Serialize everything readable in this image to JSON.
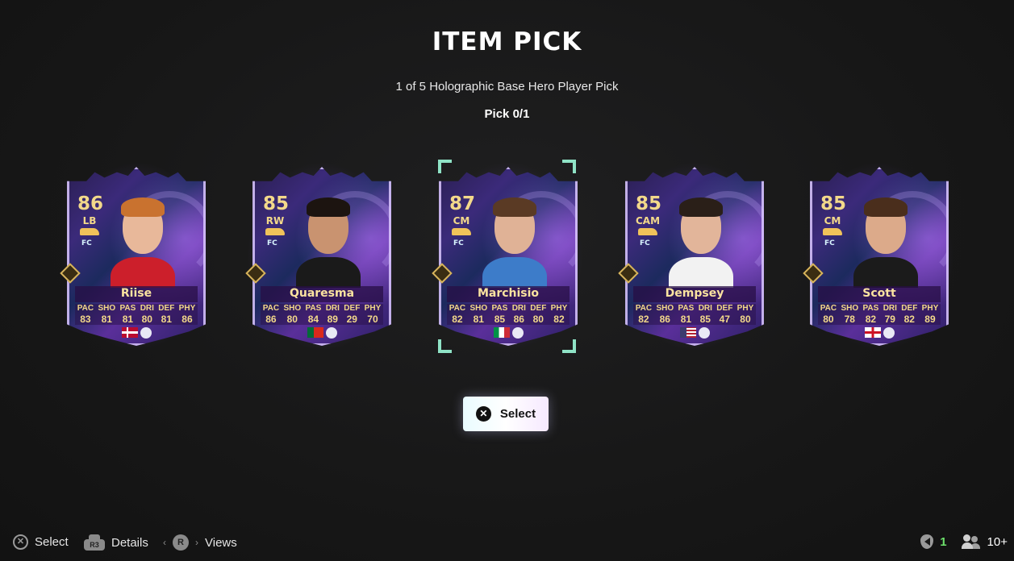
{
  "header": {
    "title": "ITEM PICK",
    "subtitle": "1 of 5 Holographic Base Hero Player Pick",
    "pick_count": "Pick 0/1"
  },
  "stat_labels": [
    "PAC",
    "SHO",
    "PAS",
    "DRI",
    "DEF",
    "PHY"
  ],
  "cards": [
    {
      "rating": "86",
      "position": "LB",
      "name": "Riise",
      "stats": [
        "83",
        "81",
        "81",
        "80",
        "81",
        "86"
      ],
      "nation": "Norway",
      "league": "Premier League",
      "skin": "#e8b89a",
      "hair": "#c9722f",
      "shirt": "#cc1f2b"
    },
    {
      "rating": "85",
      "position": "RW",
      "name": "Quaresma",
      "stats": [
        "86",
        "80",
        "84",
        "89",
        "29",
        "70"
      ],
      "nation": "Portugal",
      "league": "Liga Portugal",
      "skin": "#c99370",
      "hair": "#1c1410",
      "shirt": "#1a1a1a"
    },
    {
      "rating": "87",
      "position": "CM",
      "name": "Marchisio",
      "stats": [
        "82",
        "81",
        "85",
        "86",
        "80",
        "82"
      ],
      "nation": "Italy",
      "league": "Serie A",
      "skin": "#e0b296",
      "hair": "#5a3a24",
      "shirt": "#3d7cc9",
      "selected": true
    },
    {
      "rating": "85",
      "position": "CAM",
      "name": "Dempsey",
      "stats": [
        "82",
        "86",
        "81",
        "85",
        "47",
        "80"
      ],
      "nation": "United States",
      "league": "MLS",
      "skin": "#e2b59a",
      "hair": "#2a1f18",
      "shirt": "#f2f2f2"
    },
    {
      "rating": "85",
      "position": "CM",
      "name": "Scott",
      "stats": [
        "80",
        "78",
        "82",
        "79",
        "82",
        "89"
      ],
      "nation": "England",
      "league": "WSL",
      "skin": "#dcaa8a",
      "hair": "#4a2e1c",
      "shirt": "#1b1b1b"
    }
  ],
  "select_button": {
    "label": "Select",
    "icon": "cross-button-icon"
  },
  "footer": {
    "select_label": "Select",
    "details_label": "Details",
    "details_icon_text": "R3",
    "views_label": "Views",
    "views_icon_text": "R",
    "x_icon_text": "✕"
  },
  "status": {
    "notifications": "1",
    "players": "10+"
  },
  "colors": {
    "accent_gold": "#f3d98a",
    "selection_frame": "#8fe3c6",
    "status_green": "#6de06b"
  }
}
